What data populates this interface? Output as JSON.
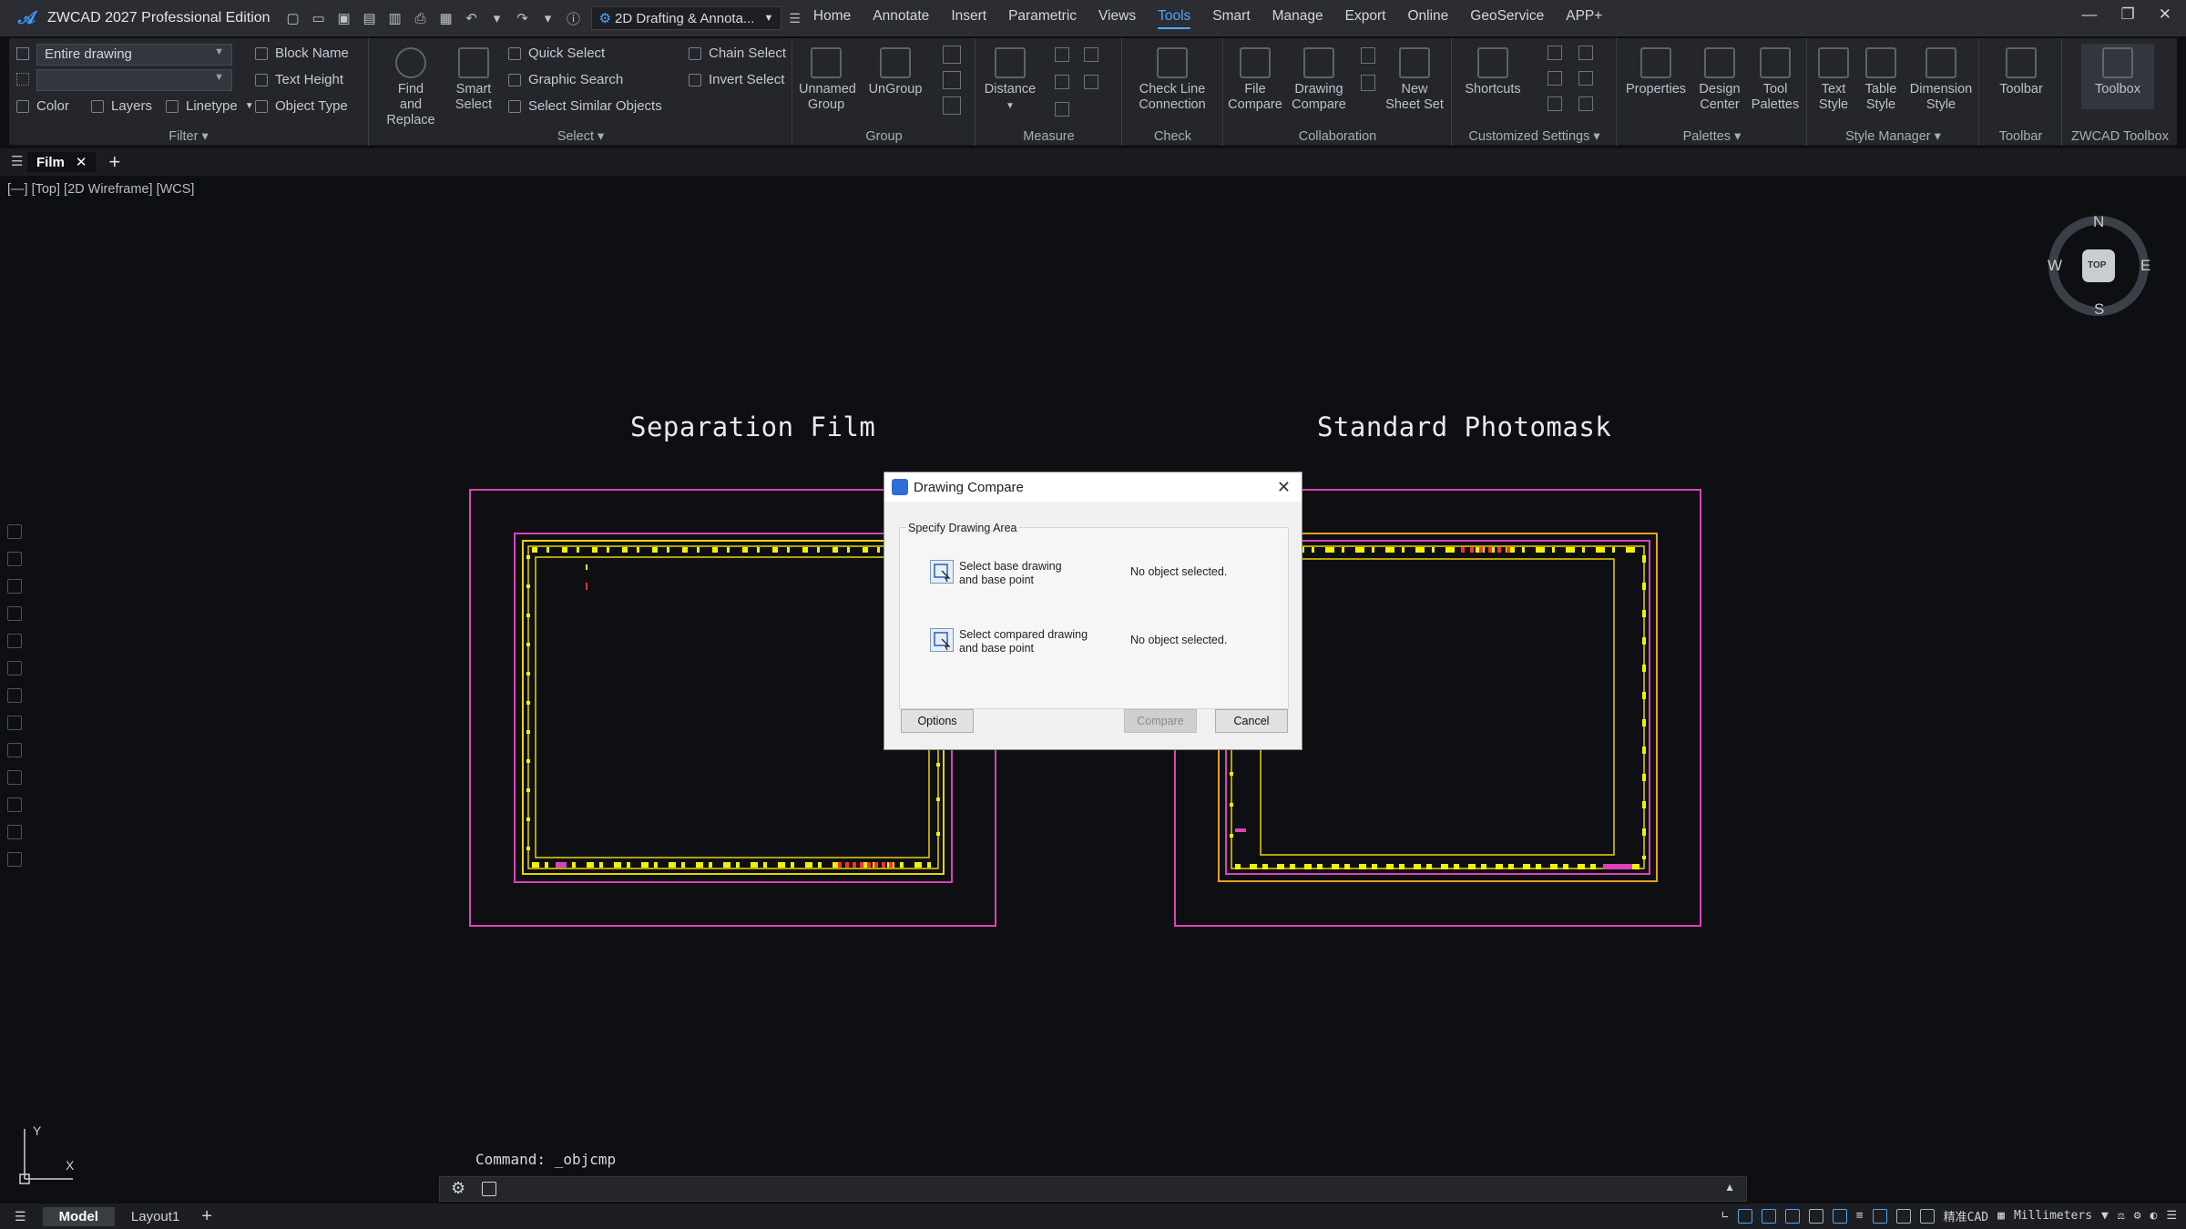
{
  "app": {
    "title": "ZWCAD 2027 Professional Edition",
    "workspace": "2D Drafting & Annota...",
    "menu": [
      "Home",
      "Annotate",
      "Insert",
      "Parametric",
      "Views",
      "Tools",
      "Smart",
      "Manage",
      "Export",
      "Online",
      "GeoService",
      "APP+"
    ],
    "active_menu": "Tools",
    "accent": "#4ea6ff"
  },
  "ribbon": {
    "filter": {
      "combo1": "Entire drawing",
      "combo2": "",
      "color": "Color",
      "layers": "Layers",
      "linetype": "Linetype",
      "block_name": "Block Name",
      "text_height": "Text Height",
      "object_type": "Object Type",
      "label": "Filter"
    },
    "select": {
      "find_replace": "Find\nand Replace",
      "smart_select": "Smart\nSelect",
      "quick_select": "Quick Select",
      "graphic_search": "Graphic Search",
      "select_similar": "Select Similar Objects",
      "chain_select": "Chain Select",
      "invert_select": "Invert Select",
      "label": "Select"
    },
    "group": {
      "unnamed": "Unnamed\nGroup",
      "ungroup": "UnGroup",
      "label": "Group"
    },
    "measure": {
      "distance": "Distance",
      "label": "Measure"
    },
    "check": {
      "check_line": "Check Line\nConnection",
      "label": "Check"
    },
    "collaboration": {
      "file_compare": "File\nCompare",
      "drawing_compare": "Drawing\nCompare",
      "new_sheet_set": "New\nSheet Set",
      "label": "Collaboration"
    },
    "customized": {
      "shortcuts": "Shortcuts",
      "label": "Customized Settings"
    },
    "palettes": {
      "properties": "Properties",
      "design_center": "Design\nCenter",
      "tool_palettes": "Tool\nPalettes",
      "label": "Palettes"
    },
    "style": {
      "text_style": "Text\nStyle",
      "table_style": "Table\nStyle",
      "dimension_style": "Dimension\nStyle",
      "label": "Style Manager"
    },
    "toolbar": {
      "toolbar": "Toolbar",
      "label": "Toolbar"
    },
    "toolbox": {
      "toolbox": "Toolbox",
      "label": "ZWCAD Toolbox"
    }
  },
  "doc_tab": "Film",
  "view_info": "[—] [Top] [2D Wireframe] [WCS]",
  "canvas": {
    "left_title": "Separation Film",
    "right_title": "Standard Photomask",
    "compass": {
      "n": "N",
      "s": "S",
      "e": "E",
      "w": "W",
      "top": "TOP"
    },
    "ucs": {
      "x": "X",
      "y": "Y"
    }
  },
  "dialog": {
    "title": "Drawing Compare",
    "group_label": "Specify Drawing Area",
    "base_label": "Select base drawing\nand base point",
    "base_status": "No object selected.",
    "compared_label": "Select compared drawing\nand base point",
    "compared_status": "No object selected.",
    "options": "Options",
    "compare": "Compare",
    "cancel": "Cancel"
  },
  "command": "Command: _objcmp",
  "status": {
    "tabs": [
      "Model",
      "Layout1"
    ],
    "active_tab": "Model",
    "units": "Millimeters",
    "zwcad_label": "精准CAD"
  }
}
